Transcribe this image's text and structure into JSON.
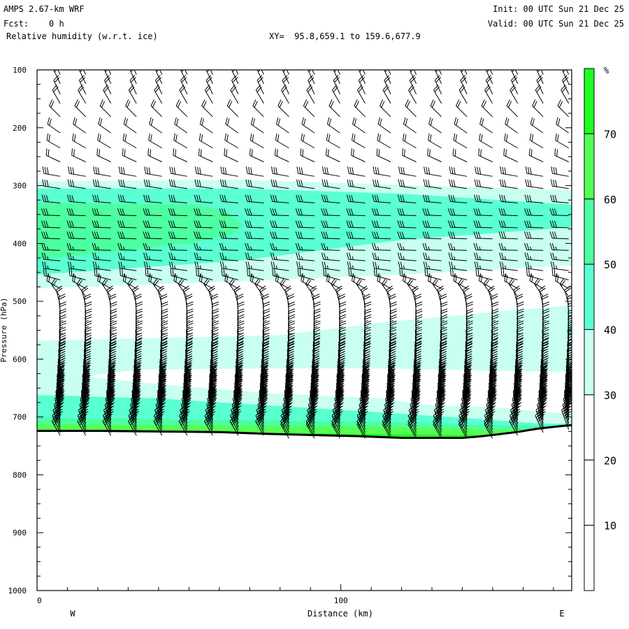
{
  "header": {
    "model": "AMPS 2.67-km WRF",
    "forecast": "Fcst:    0 h",
    "field": "Relative humidity (w.r.t. ice)",
    "xy": "XY=  95.8,659.1 to 159.6,677.9",
    "init": "Init: 00 UTC Sun 21 Dec 25",
    "valid": "Valid: 00 UTC Sun 21 Dec 25"
  },
  "chart_data": {
    "type": "area",
    "xlabel": "Distance (km)",
    "ylabel": "Pressure (hPa)",
    "xlim": [
      0,
      176
    ],
    "ylim": [
      100,
      1000
    ],
    "x_ticks": [
      "0",
      "100"
    ],
    "x_minor_step": 10,
    "y_ticks": [
      "100",
      "200",
      "300",
      "400",
      "500",
      "600",
      "700",
      "800",
      "900",
      "1000"
    ],
    "side_labels": {
      "left": "W",
      "right": "E"
    },
    "colorbar": {
      "unit": "%",
      "labels": [
        "70",
        "60",
        "50",
        "40",
        "30",
        "20",
        "10"
      ],
      "bands": [
        {
          "range": ">70",
          "color": "#1eff1e"
        },
        {
          "range": "60-70",
          "color": "#55ff55"
        },
        {
          "range": "50-60",
          "color": "#4dffa0"
        },
        {
          "range": "40-50",
          "color": "#5affd2"
        },
        {
          "range": "30-40",
          "color": "#c8fff0"
        },
        {
          "range": "20-30",
          "color": "#ffffff"
        },
        {
          "range": "10-20",
          "color": "#ffffff"
        },
        {
          "range": "<10",
          "color": "#ffffff"
        }
      ]
    },
    "rh_regions": [
      {
        "band": "30-40",
        "color": "#c8fff0",
        "points": [
          [
            0,
            293
          ],
          [
            66,
            290
          ],
          [
            176,
            308
          ],
          [
            176,
            438
          ],
          [
            120,
            454
          ],
          [
            68,
            465
          ],
          [
            0,
            478
          ]
        ]
      },
      {
        "band": "40-50",
        "color": "#5affd2",
        "points": [
          [
            0,
            305
          ],
          [
            66,
            305
          ],
          [
            120,
            314
          ],
          [
            176,
            333
          ],
          [
            176,
            372
          ],
          [
            120,
            394
          ],
          [
            66,
            430
          ],
          [
            0,
            454
          ]
        ]
      },
      {
        "band": "50-60",
        "color": "#4dffa0",
        "points": [
          [
            0,
            330
          ],
          [
            53,
            333
          ],
          [
            62,
            345
          ],
          [
            68,
            368
          ],
          [
            64,
            385
          ],
          [
            50,
            400
          ],
          [
            0,
            428
          ]
        ]
      },
      {
        "band": "30-40",
        "color": "#c8fff0",
        "points": [
          [
            0,
            568
          ],
          [
            79,
            559
          ],
          [
            113,
            537
          ],
          [
            147,
            520
          ],
          [
            176,
            507
          ],
          [
            176,
            780
          ],
          [
            0,
            780
          ]
        ]
      },
      {
        "band": "<30",
        "color": "#ffffff",
        "points": [
          [
            16,
            630
          ],
          [
            33,
            618
          ],
          [
            80,
            616
          ],
          [
            113,
            616
          ],
          [
            150,
            620
          ],
          [
            176,
            622
          ],
          [
            176,
            695
          ],
          [
            150,
            683
          ],
          [
            130,
            680
          ],
          [
            113,
            668
          ],
          [
            80,
            660
          ],
          [
            50,
            648
          ],
          [
            30,
            638
          ]
        ]
      },
      {
        "band": "40-50",
        "color": "#5affd2",
        "points": [
          [
            176,
            538
          ],
          [
            174.5,
            545
          ],
          [
            174.5,
            555
          ],
          [
            176,
            562
          ]
        ]
      },
      {
        "band": "40-50",
        "color": "#5affd2",
        "points": [
          [
            0,
            662
          ],
          [
            40,
            668
          ],
          [
            113,
            692
          ],
          [
            147,
            704
          ],
          [
            165,
            711
          ],
          [
            176,
            712
          ],
          [
            176,
            780
          ],
          [
            0,
            780
          ]
        ]
      },
      {
        "band": "50-60",
        "color": "#4dffa0",
        "points": [
          [
            0,
            702
          ],
          [
            113,
            708
          ],
          [
            147,
            714
          ],
          [
            176,
            716
          ],
          [
            176,
            780
          ],
          [
            0,
            780
          ]
        ]
      },
      {
        "band": "60-70",
        "color": "#55ff55",
        "points": [
          [
            0,
            712
          ],
          [
            113,
            717
          ],
          [
            150,
            722
          ],
          [
            176,
            722
          ],
          [
            176,
            780
          ],
          [
            0,
            780
          ]
        ]
      },
      {
        "band": ">70",
        "color": "#1eff1e",
        "points": [
          [
            70,
            727
          ],
          [
            100,
            729
          ],
          [
            140,
            731
          ],
          [
            150,
            731
          ],
          [
            150,
            780
          ],
          [
            70,
            780
          ]
        ]
      }
    ],
    "surface_pressure": [
      [
        0,
        724
      ],
      [
        20,
        724
      ],
      [
        40,
        725
      ],
      [
        60,
        726
      ],
      [
        75,
        729
      ],
      [
        90,
        731
      ],
      [
        105,
        733
      ],
      [
        120,
        736
      ],
      [
        140,
        736
      ],
      [
        145,
        734
      ],
      [
        150,
        731
      ],
      [
        158,
        726
      ],
      [
        165,
        720
      ],
      [
        172,
        716
      ],
      [
        176,
        714
      ]
    ],
    "wind_barbs": {
      "stations_km": [
        4.4,
        12.8,
        21.1,
        29.5,
        37.9,
        46.2,
        54.6,
        63,
        71.4,
        79.7,
        88.1,
        96.5,
        104.8,
        113.2,
        121.6,
        129.9,
        138.3,
        146.7,
        155,
        163.4,
        171.8
      ],
      "levels": [
        {
          "p": 108,
          "dir": 335,
          "kt": 20
        },
        {
          "p": 124,
          "dir": 335,
          "kt": 20
        },
        {
          "p": 142,
          "dir": 335,
          "kt": 20
        },
        {
          "p": 158,
          "dir": 330,
          "kt": 20
        },
        {
          "p": 181,
          "dir": 315,
          "kt": 20
        },
        {
          "p": 209,
          "dir": 305,
          "kt": 20
        },
        {
          "p": 235,
          "dir": 300,
          "kt": 20
        },
        {
          "p": 259,
          "dir": 295,
          "kt": 20
        },
        {
          "p": 284,
          "dir": 280,
          "kt": 30
        },
        {
          "p": 305,
          "dir": 278,
          "kt": 30
        },
        {
          "p": 330,
          "dir": 275,
          "kt": 30
        },
        {
          "p": 352,
          "dir": 272,
          "kt": 30
        },
        {
          "p": 373,
          "dir": 272,
          "kt": 30
        },
        {
          "p": 392,
          "dir": 272,
          "kt": 30
        },
        {
          "p": 412,
          "dir": 272,
          "kt": 25
        },
        {
          "p": 430,
          "dir": 275,
          "kt": 25
        },
        {
          "p": 447,
          "dir": 278,
          "kt": 25
        },
        {
          "p": 463,
          "dir": 285,
          "kt": 25
        },
        {
          "p": 478,
          "dir": 300,
          "kt": 20
        },
        {
          "p": 492,
          "dir": 325,
          "kt": 20
        },
        {
          "p": 506,
          "dir": 345,
          "kt": 20
        },
        {
          "p": 519,
          "dir": 355,
          "kt": 20
        },
        {
          "p": 532,
          "dir": 358,
          "kt": 20
        },
        {
          "p": 544,
          "dir": 358,
          "kt": 20
        },
        {
          "p": 556,
          "dir": 358,
          "kt": 25
        },
        {
          "p": 567,
          "dir": 358,
          "kt": 25
        },
        {
          "p": 578,
          "dir": 357,
          "kt": 25
        },
        {
          "p": 588,
          "dir": 357,
          "kt": 30
        },
        {
          "p": 598,
          "dir": 356,
          "kt": 30
        },
        {
          "p": 607,
          "dir": 356,
          "kt": 35
        },
        {
          "p": 616,
          "dir": 355,
          "kt": 35
        },
        {
          "p": 624,
          "dir": 355,
          "kt": 40
        },
        {
          "p": 632,
          "dir": 354,
          "kt": 40
        },
        {
          "p": 640,
          "dir": 354,
          "kt": 45
        },
        {
          "p": 647,
          "dir": 353,
          "kt": 45
        },
        {
          "p": 654,
          "dir": 353,
          "kt": 50
        },
        {
          "p": 661,
          "dir": 352,
          "kt": 50
        },
        {
          "p": 668,
          "dir": 352,
          "kt": 55
        },
        {
          "p": 675,
          "dir": 352,
          "kt": 55
        },
        {
          "p": 681,
          "dir": 351,
          "kt": 60
        },
        {
          "p": 687,
          "dir": 351,
          "kt": 60
        },
        {
          "p": 693,
          "dir": 350,
          "kt": 60
        },
        {
          "p": 699,
          "dir": 350,
          "kt": 65
        },
        {
          "p": 705,
          "dir": 350,
          "kt": 65
        },
        {
          "p": 711,
          "dir": 348,
          "kt": 65
        },
        {
          "p": 717,
          "dir": 345,
          "kt": 60
        },
        {
          "p": 722,
          "dir": 340,
          "kt": 50
        },
        {
          "p": 727,
          "dir": 335,
          "kt": 40
        },
        {
          "p": 732,
          "dir": 330,
          "kt": 30
        },
        {
          "p": 737,
          "dir": 330,
          "kt": 25
        }
      ]
    }
  }
}
